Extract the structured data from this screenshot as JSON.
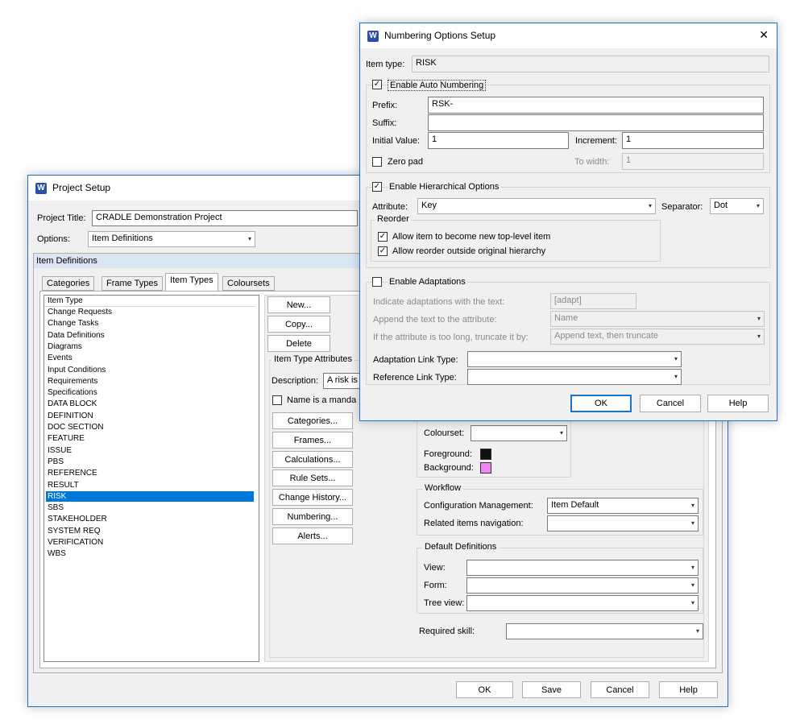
{
  "project_setup": {
    "title": "Project Setup",
    "project_title_label": "Project Title:",
    "project_title_value": "CRADLE Demonstration Project",
    "options_label": "Options:",
    "options_value": "Item Definitions",
    "section_header": "Item Definitions",
    "tabs": [
      {
        "label": "Categories"
      },
      {
        "label": "Frame Types"
      },
      {
        "label": "Item Types"
      },
      {
        "label": "Coloursets"
      }
    ],
    "list_header": "Item Type",
    "item_types": [
      "Change Requests",
      "Change Tasks",
      "Data Definitions",
      "Diagrams",
      "Events",
      "Input Conditions",
      "Requirements",
      "Specifications",
      "DATA BLOCK",
      "DEFINITION",
      "DOC SECTION",
      "FEATURE",
      "ISSUE",
      "PBS",
      "REFERENCE",
      "RESULT",
      "RISK",
      "SBS",
      "STAKEHOLDER",
      "SYSTEM REQ",
      "VERIFICATION",
      "WBS"
    ],
    "selected_item": "RISK",
    "buttons_top": {
      "new": "New...",
      "copy": "Copy...",
      "delete": "Delete"
    },
    "attributes_group": "Item Type Attributes",
    "description_label": "Description:",
    "description_value": "A risk is",
    "name_mandatory": "Name is a manda",
    "side_buttons": {
      "categories": "Categories...",
      "frames": "Frames...",
      "calculations": "Calculations...",
      "rule_sets": "Rule Sets...",
      "change_history": "Change History...",
      "numbering": "Numbering...",
      "alerts": "Alerts..."
    },
    "colourset_label": "Colourset:",
    "colourset_value": "",
    "foreground_label": "Foreground:",
    "foreground_color": "#111111",
    "background_label": "Background:",
    "background_color": "#ee88ee",
    "workflow": {
      "title": "Workflow",
      "config_label": "Configuration Management:",
      "config_value": "Item Default",
      "nav_label": "Related items navigation:",
      "nav_value": ""
    },
    "defaults": {
      "title": "Default Definitions",
      "view_label": "View:",
      "form_label": "Form:",
      "tree_label": "Tree view:"
    },
    "required_skill_label": "Required skill:",
    "footer": {
      "ok": "OK",
      "save": "Save",
      "cancel": "Cancel",
      "help": "Help"
    }
  },
  "numbering": {
    "title": "Numbering Options Setup",
    "close_glyph": "✕",
    "item_type_label": "Item type:",
    "item_type_value": "RISK",
    "auto": {
      "label": "Enable Auto Numbering",
      "checked": true,
      "prefix_label": "Prefix:",
      "prefix_value": "RSK-",
      "suffix_label": "Suffix:",
      "suffix_value": "",
      "initial_label": "Initial Value:",
      "initial_value": "1",
      "increment_label": "Increment:",
      "increment_value": "1",
      "zeropad_label": "Zero pad",
      "width_label": "To width:",
      "width_value": "1"
    },
    "hier": {
      "label": "Enable Hierarchical Options",
      "checked": true,
      "attribute_label": "Attribute:",
      "attribute_value": "Key",
      "separator_label": "Separator:",
      "separator_value": "Dot",
      "reorder_title": "Reorder",
      "opt1": "Allow item to become new top-level item",
      "opt2": "Allow reorder outside original hierarchy"
    },
    "adapt": {
      "label": "Enable Adaptations",
      "checked": false,
      "indicate_label": "Indicate adaptations with the text:",
      "indicate_value": "[adapt]",
      "append_label": "Append the text to the attribute:",
      "append_value": "Name",
      "truncate_label": "If the attribute is too long, truncate it by:",
      "truncate_value": "Append text, then truncate",
      "link_label": "Adaptation Link Type:",
      "ref_label": "Reference Link Type:"
    },
    "footer": {
      "ok": "OK",
      "cancel": "Cancel",
      "help": "Help"
    }
  },
  "icons": {
    "app_icon": "W",
    "check": "✓",
    "dropdown": "▾"
  }
}
